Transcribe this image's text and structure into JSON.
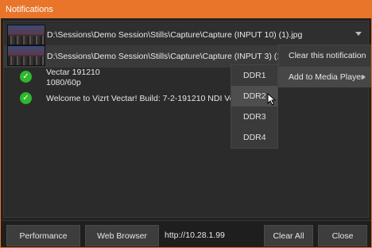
{
  "window": {
    "title": "Notifications",
    "accent": "#e8752a"
  },
  "notifications": [
    {
      "thumbnail": "stills-capture-thumbnail",
      "path": "D:\\Sessions\\Demo Session\\Stills\\Capture\\Capture (INPUT 10) (1).jpg"
    },
    {
      "thumbnail": "stills-capture-thumbnail",
      "path": "D:\\Sessions\\Demo Session\\Stills\\Capture\\Capture (INPUT 3) (1).jpg"
    },
    {
      "icon": "check-circle-icon",
      "line1": "Vectar 191210",
      "line2": "1080/60p"
    },
    {
      "icon": "check-circle-icon",
      "message": "Welcome to Vizrt Vectar! Build: 7-2-191210 NDI Version:"
    }
  ],
  "context_menu": {
    "items": [
      "Clear this notification",
      "Add to Media Player"
    ],
    "submenu": [
      "DDR1",
      "DDR2",
      "DDR3",
      "DDR4"
    ]
  },
  "footer": {
    "performance_label": "Performance",
    "web_browser_label": "Web Browser",
    "url": "http://10.28.1.99",
    "clear_all_label": "Clear All",
    "close_label": "Close"
  }
}
